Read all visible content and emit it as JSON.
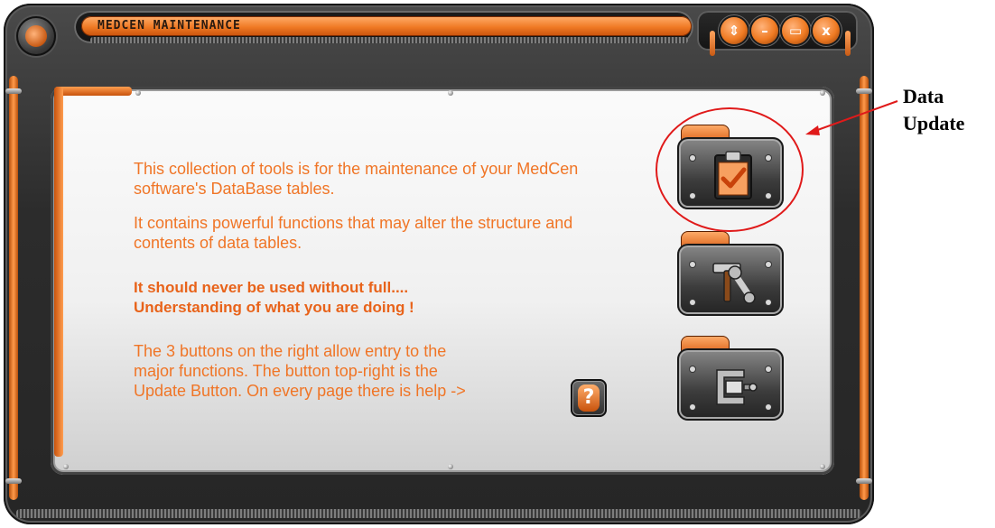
{
  "window": {
    "title": "MEDCEN MAINTENANCE",
    "controls": {
      "resize": "⇕",
      "minimize": "–",
      "restore": "▭",
      "close": "x"
    }
  },
  "content": {
    "paragraph1": "This collection of tools is for the maintenance of your MedCen software's DataBase tables.",
    "paragraph2": "It contains powerful functions that may alter the structure and contents of data tables.",
    "warning_line1": "It should never be used without full....",
    "warning_line2": "Understanding of what you are doing !",
    "paragraph3_line1": "The 3 buttons on the right allow entry to the",
    "paragraph3_line2": "major functions. The button top-right is the",
    "paragraph3_line3": "Update Button. On every page there is help ->",
    "help_glyph": "?"
  },
  "buttons": [
    {
      "icon": "clipboard-check-icon"
    },
    {
      "icon": "tools-icon"
    },
    {
      "icon": "clamp-icon"
    }
  ],
  "annotation": {
    "line1": "Data",
    "line2": "Update"
  },
  "colors": {
    "accent": "#f07526",
    "annotation": "#e01a1a"
  }
}
